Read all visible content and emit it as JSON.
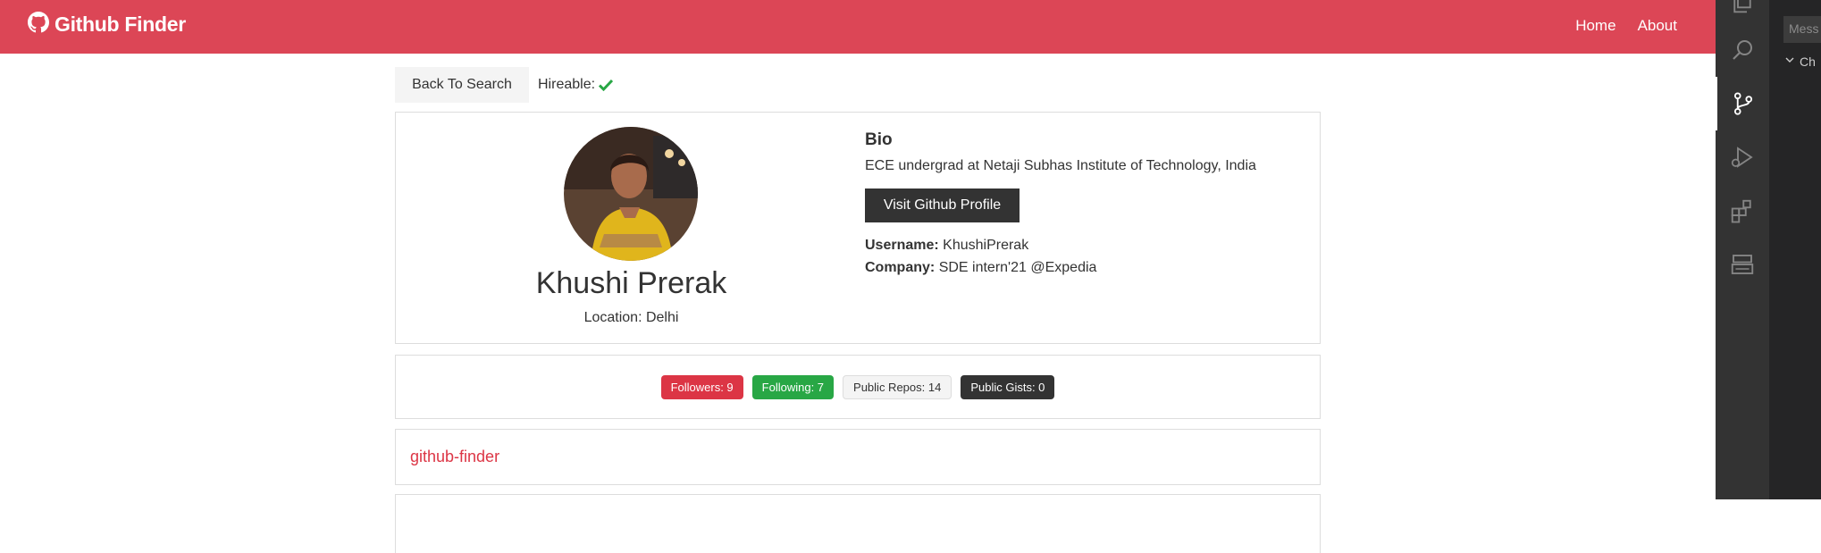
{
  "navbar": {
    "brand_icon": "github-icon",
    "title": "Github Finder",
    "links": [
      "Home",
      "About"
    ]
  },
  "toolbar": {
    "back_label": "Back To Search",
    "hireable_label": "Hireable:",
    "hireable_icon": "check-icon"
  },
  "profile": {
    "name": "Khushi Prerak",
    "location": "Location: Delhi",
    "bio_title": "Bio",
    "bio": "ECE undergrad at Netaji Subhas Institute of Technology, India",
    "visit_label": "Visit Github Profile",
    "username_label": "Username:",
    "username": "KhushiPrerak",
    "company_label": "Company:",
    "company": "SDE intern'21 @Expedia"
  },
  "stats": {
    "followers": "Followers: 9",
    "following": "Following: 7",
    "repos": "Public Repos: 14",
    "gists": "Public Gists: 0"
  },
  "repos": [
    "github-finder"
  ],
  "vscode": {
    "activity_icons": [
      "files-icon",
      "search-icon",
      "source-control-icon",
      "run-debug-icon",
      "extensions-icon",
      "remote-explorer-icon"
    ],
    "message_placeholder": "Mess",
    "changes_label": "Ch"
  },
  "colors": {
    "navbar": "#dc4656",
    "primary": "#dc3545",
    "success": "#28a745",
    "dark": "#333333"
  }
}
